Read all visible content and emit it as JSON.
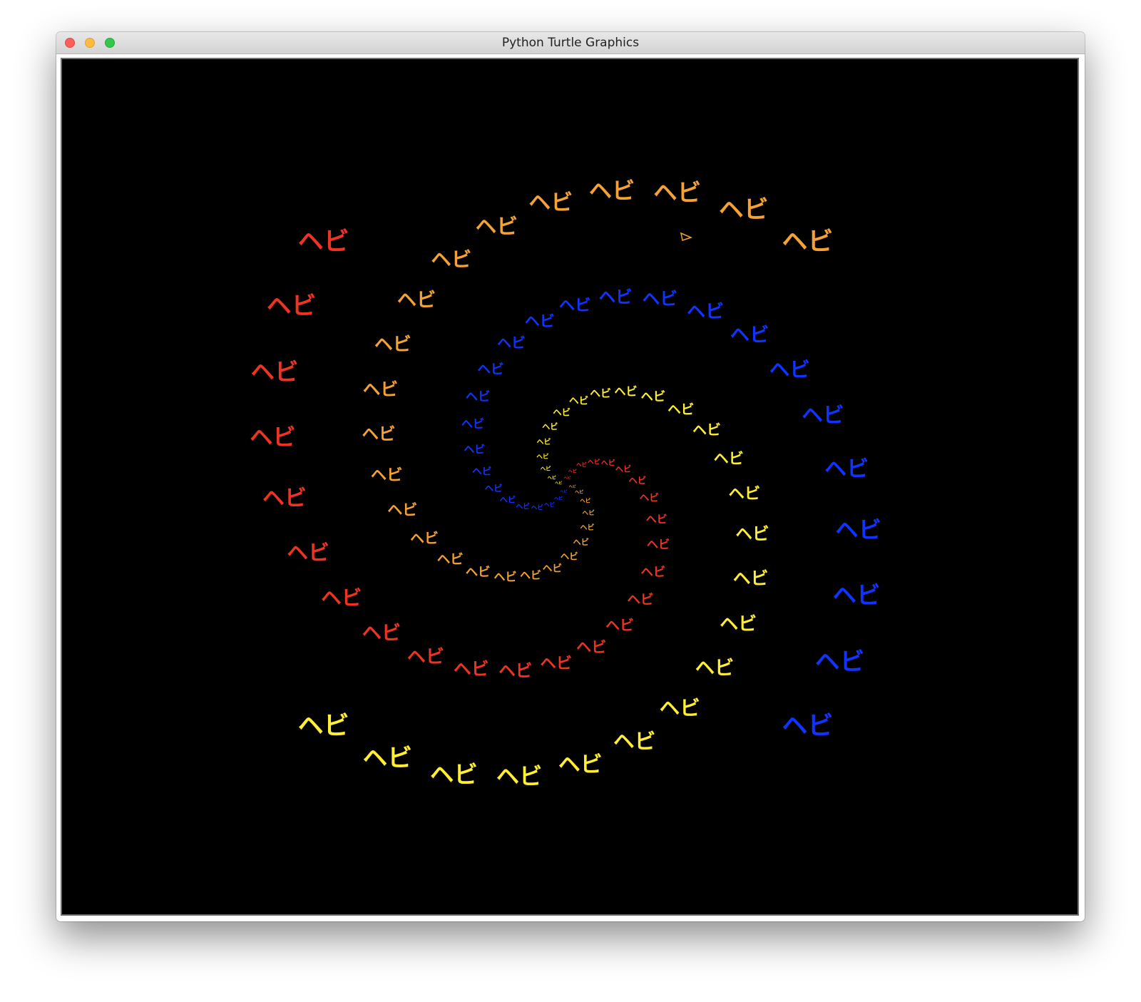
{
  "window": {
    "title": "Python Turtle Graphics",
    "buttons": [
      "close",
      "minimize",
      "zoom"
    ]
  },
  "canvas": {
    "background": "#000000",
    "stamp_text": "ヘビ",
    "arms": [
      {
        "name": "red",
        "color": "#ee3322"
      },
      {
        "name": "orange",
        "color": "#f4a235"
      },
      {
        "name": "blue",
        "color": "#1133ff"
      },
      {
        "name": "yellow",
        "color": "#ffee33"
      }
    ],
    "turtle_cursor": {
      "shape": "classic-arrow-icon",
      "color": "#f4a235"
    }
  }
}
